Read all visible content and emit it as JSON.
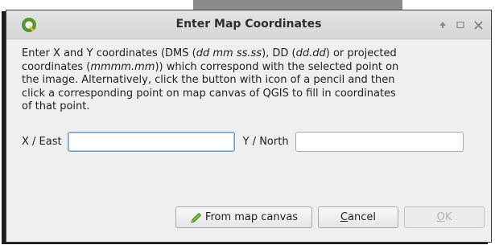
{
  "window": {
    "title": "Enter Map Coordinates",
    "icons": [
      "qgis-logo-icon",
      "pin-icon",
      "maximize-icon",
      "close-icon"
    ]
  },
  "description": {
    "line1_a": "Enter X and Y coordinates (DMS (",
    "line1_b": "dd mm ss.ss",
    "line1_c": "), DD (",
    "line1_d": "dd.dd",
    "line1_e": ") or projected",
    "line2_a": "coordinates (",
    "line2_b": "mmmm.mm",
    "line2_c": ")) which correspond with the selected point on",
    "line3": "the image. Alternatively, click the button with icon of a pencil and then",
    "line4": "click a corresponding point on map canvas of QGIS to fill in coordinates",
    "line5": "of that point."
  },
  "fields": {
    "x_label": "X / East",
    "x_value": "",
    "y_label": "Y / North",
    "y_value": ""
  },
  "buttons": {
    "from_map_canvas": "From map canvas",
    "cancel_first": "C",
    "cancel_rest": "ancel",
    "ok_first": "O",
    "ok_rest": "K"
  },
  "colors": {
    "focus_border": "#6a9fd0",
    "disabled_text": "#b4b4b4",
    "qgis_green": "#589632",
    "qgis_yellow": "#f0c41b"
  }
}
